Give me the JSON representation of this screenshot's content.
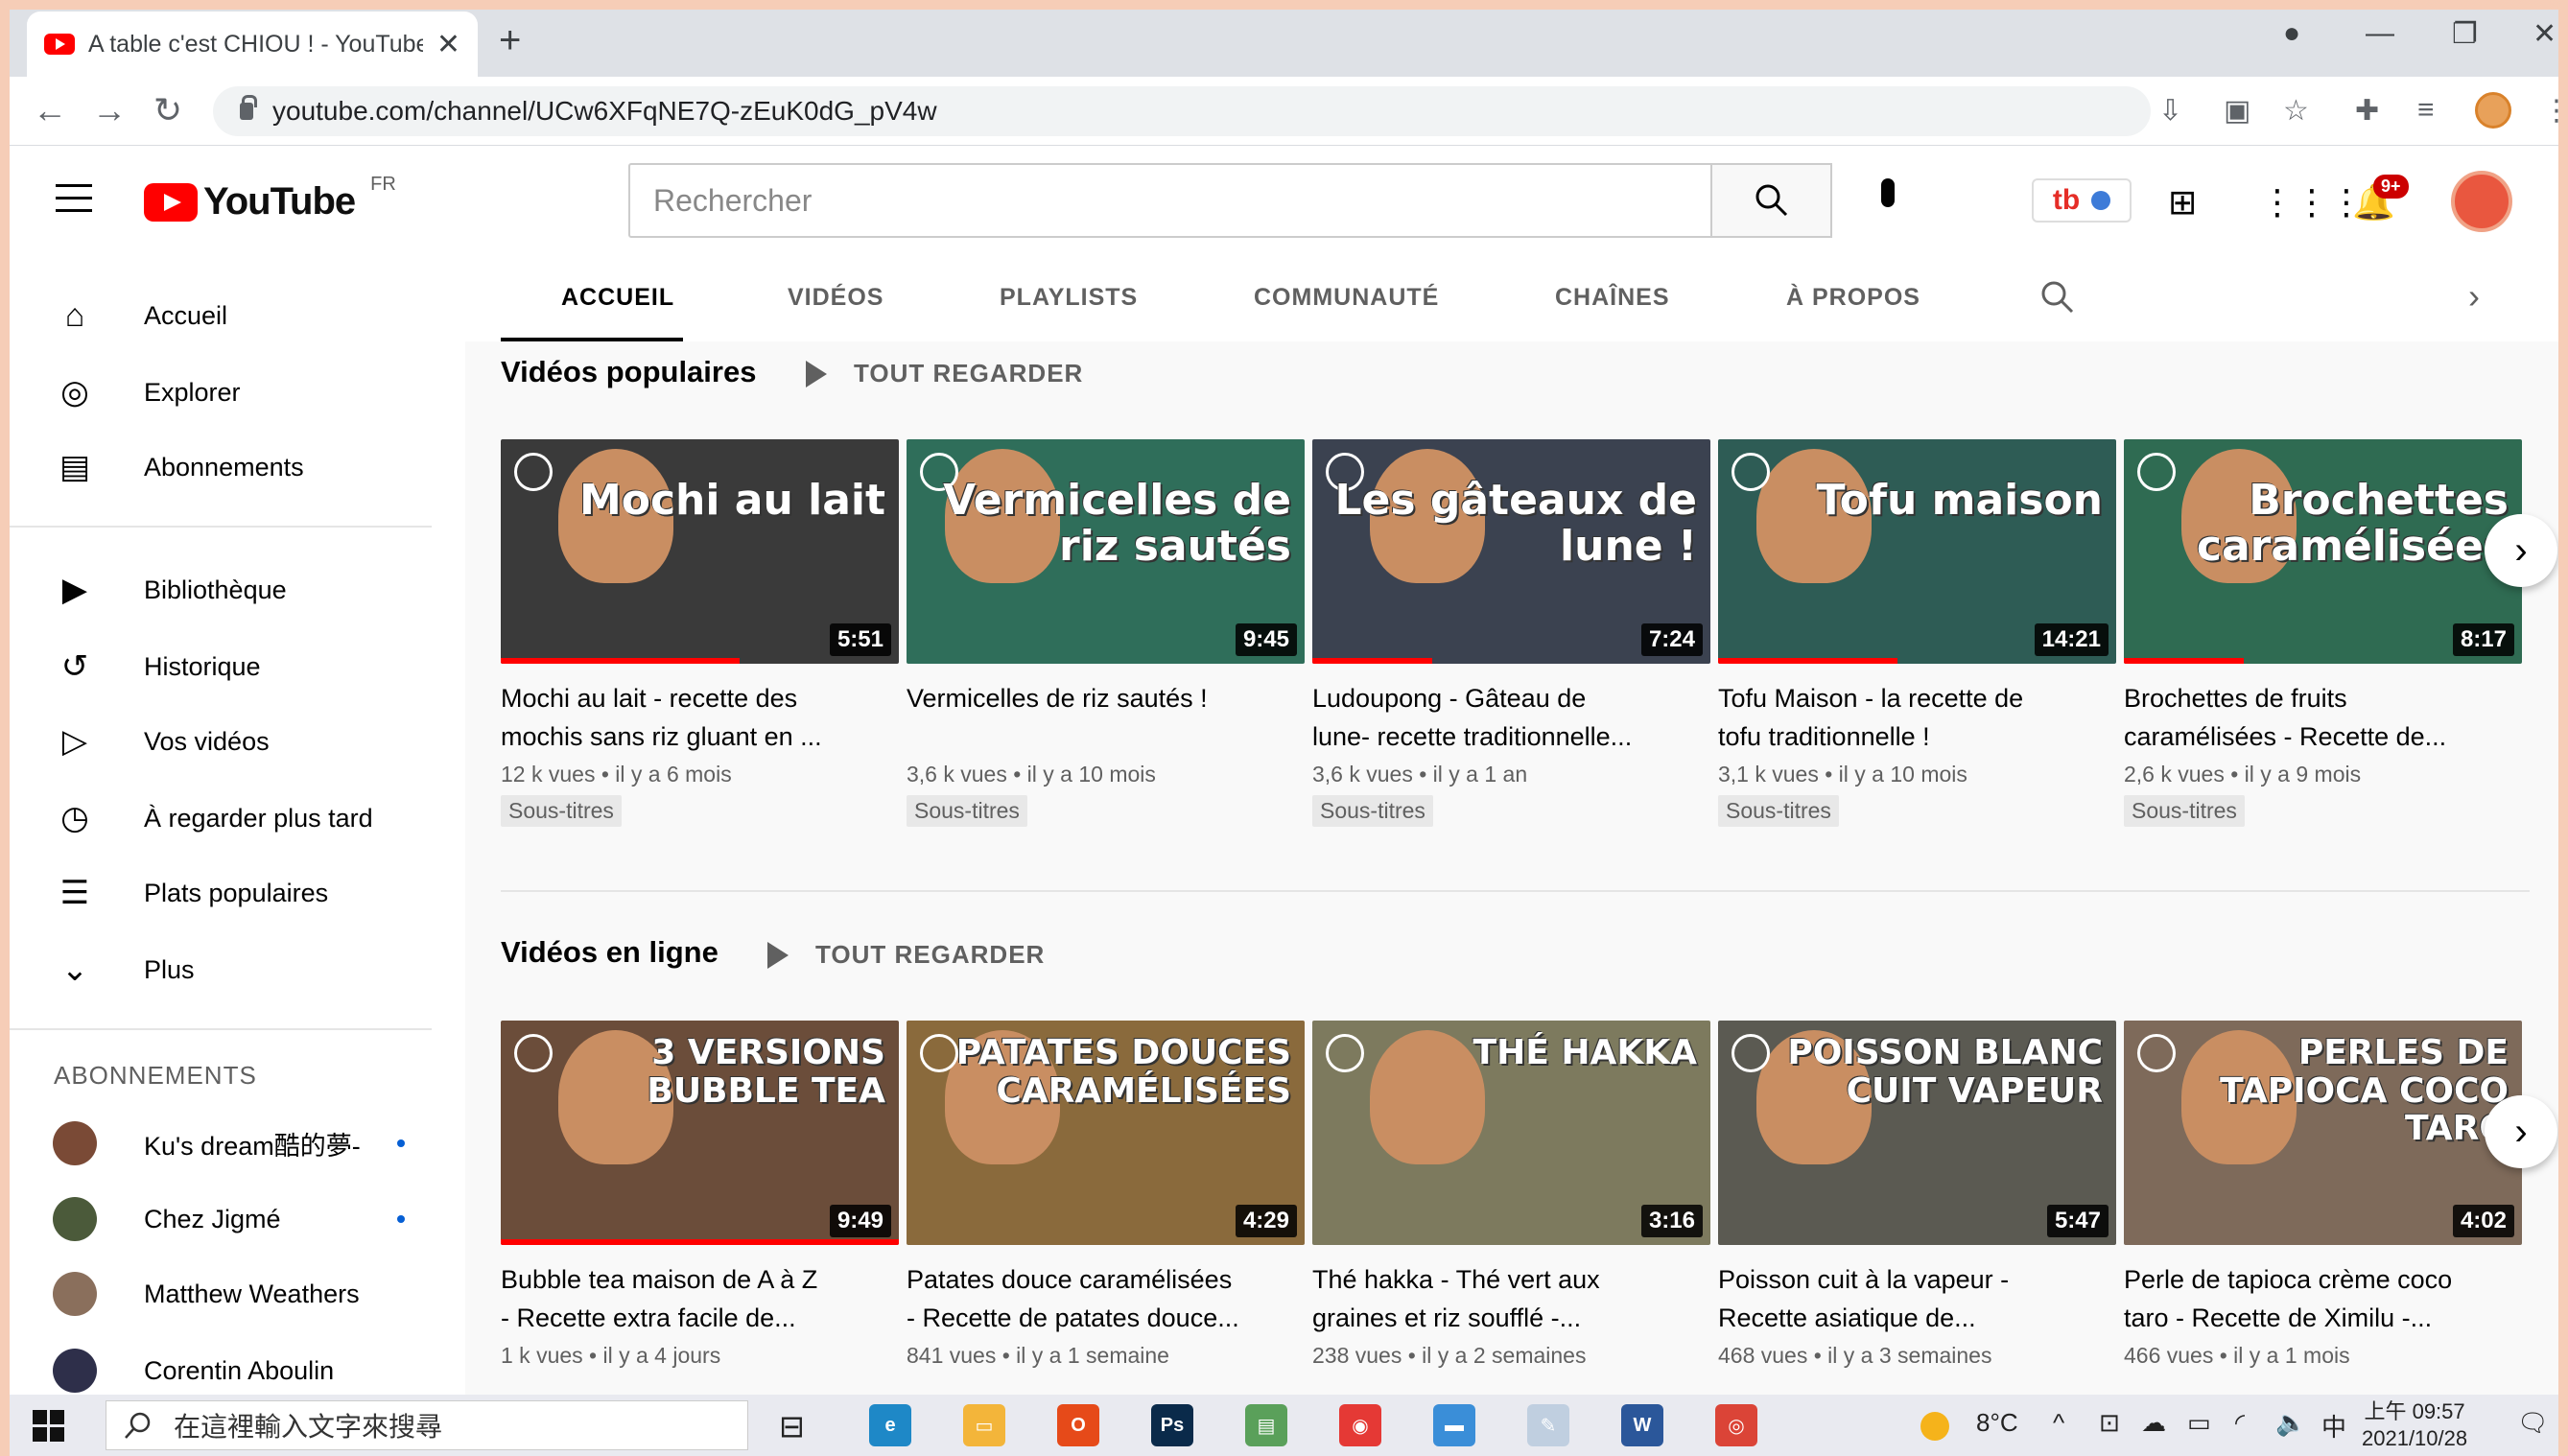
{
  "browser": {
    "tab_title": "A table c'est CHIOU ! - YouTube",
    "tab_close": "✕",
    "new_tab": "+",
    "url": "youtube.com/channel/UCw6XFqNE7Q-zEuK0dG_pV4w"
  },
  "masthead": {
    "logo_text": "YouTube",
    "region": "FR",
    "search_placeholder": "Rechercher",
    "notifications_badge": "9+"
  },
  "sidebar": {
    "main_items": [
      {
        "label": "Accueil",
        "icon": "home-icon"
      },
      {
        "label": "Explorer",
        "icon": "compass-icon"
      },
      {
        "label": "Abonnements",
        "icon": "subscriptions-icon"
      }
    ],
    "library_items": [
      {
        "label": "Bibliothèque",
        "icon": "library-icon"
      },
      {
        "label": "Historique",
        "icon": "history-icon"
      },
      {
        "label": "Vos vidéos",
        "icon": "your-videos-icon"
      },
      {
        "label": "À regarder plus tard",
        "icon": "watch-later-icon"
      },
      {
        "label": "Plats populaires",
        "icon": "playlist-icon"
      },
      {
        "label": "Plus",
        "icon": "chevron-down-icon"
      }
    ],
    "subscriptions_heading": "ABONNEMENTS",
    "subscriptions": [
      {
        "name": "Ku's dream酷的夢-",
        "new": true,
        "color": "#7a4a36"
      },
      {
        "name": "Chez Jigmé",
        "new": true,
        "color": "#4b5a3a"
      },
      {
        "name": "Matthew Weathers",
        "new": false,
        "color": "#8a6f5c"
      },
      {
        "name": "Corentin Aboulin",
        "new": false,
        "color": "#2e2f4a"
      }
    ]
  },
  "channel_tabs": [
    "ACCUEIL",
    "VIDÉOS",
    "PLAYLISTS",
    "COMMUNAUTÉ",
    "CHAÎNES",
    "À PROPOS"
  ],
  "shelves": [
    {
      "title": "Vidéos populaires",
      "play_all": "TOUT REGARDER",
      "videos": [
        {
          "overlay": "Mochi au lait",
          "duration": "5:51",
          "title_l1": "Mochi au lait - recette des",
          "title_l2": "mochis sans riz gluant en ...",
          "meta": "12 k vues • il y a 6 mois",
          "badge": "Sous-titres",
          "bg": "#3a3a3a",
          "progress": 0.6
        },
        {
          "overlay": "Vermicelles de riz sautés",
          "duration": "9:45",
          "title_l1": "Vermicelles de riz sautés !",
          "title_l2": "",
          "meta": "3,6 k vues • il y a 10 mois",
          "badge": "Sous-titres",
          "bg": "#2f6e5a",
          "progress": 0
        },
        {
          "overlay": "Les gâteaux de lune !",
          "duration": "7:24",
          "title_l1": "Ludoupong - Gâteau de",
          "title_l2": "lune- recette traditionnelle...",
          "meta": "3,6 k vues • il y a 1 an",
          "badge": "Sous-titres",
          "bg": "#3b4250",
          "progress": 0.3
        },
        {
          "overlay": "Tofu maison",
          "duration": "14:21",
          "title_l1": "Tofu Maison - la recette de",
          "title_l2": "tofu traditionnelle !",
          "meta": "3,1 k vues • il y a 10 mois",
          "badge": "Sous-titres",
          "bg": "#2e5c55",
          "progress": 0.45
        },
        {
          "overlay": "Brochettes caramélisées",
          "duration": "8:17",
          "title_l1": "Brochettes de fruits",
          "title_l2": "caramélisées - Recette de...",
          "meta": "2,6 k vues • il y a 9 mois",
          "badge": "Sous-titres",
          "bg": "#2f6b52",
          "progress": 0.3
        }
      ]
    },
    {
      "title": "Vidéos en ligne",
      "play_all": "TOUT REGARDER",
      "videos": [
        {
          "overlay": "3 VERSIONS BUBBLE TEA",
          "duration": "9:49",
          "title_l1": "Bubble tea maison de A à Z",
          "title_l2": "- Recette extra facile de...",
          "meta": "1 k vues • il y a 4 jours",
          "badge": "",
          "bg": "#6b4d3a",
          "progress": 1.0
        },
        {
          "overlay": "PATATES DOUCES CARAMÉLISÉES",
          "duration": "4:29",
          "title_l1": "Patates douce caramélisées",
          "title_l2": "- Recette de patates douce...",
          "meta": "841 vues • il y a 1 semaine",
          "badge": "",
          "bg": "#8a6a3c",
          "progress": 0
        },
        {
          "overlay": "THÉ HAKKA",
          "duration": "3:16",
          "title_l1": "Thé hakka - Thé vert aux",
          "title_l2": "graines et riz soufflé -...",
          "meta": "238 vues • il y a 2 semaines",
          "badge": "",
          "bg": "#7d7a5e",
          "progress": 0
        },
        {
          "overlay": "POISSON BLANC CUIT VAPEUR",
          "duration": "5:47",
          "title_l1": "Poisson cuit à la vapeur -",
          "title_l2": "Recette asiatique de...",
          "meta": "468 vues • il y a 3 semaines",
          "badge": "",
          "bg": "#5b5a52",
          "progress": 0
        },
        {
          "overlay": "PERLES DE TAPIOCA COCO TARO",
          "duration": "4:02",
          "title_l1": "Perle de tapioca crème coco",
          "title_l2": "taro - Recette de Ximilu -...",
          "meta": "466 vues • il y a 1 mois",
          "badge": "",
          "bg": "#7e6a5a",
          "progress": 0
        }
      ]
    }
  ],
  "taskbar": {
    "search_placeholder": "在這裡輸入文字來搜尋",
    "weather": "8°C",
    "ime": "中",
    "time": "上午 09:57",
    "date": "2021/10/28",
    "apps": [
      {
        "name": "Edge",
        "color": "#1e88c7",
        "label": "e"
      },
      {
        "name": "Files",
        "color": "#f3b53a",
        "label": "▭"
      },
      {
        "name": "Office",
        "color": "#e64a19",
        "label": "O"
      },
      {
        "name": "Photoshop",
        "color": "#0a2a4a",
        "label": "Ps"
      },
      {
        "name": "App",
        "color": "#5aa05a",
        "label": "▤"
      },
      {
        "name": "App2",
        "color": "#e53935",
        "label": "◉"
      },
      {
        "name": "Monitor",
        "color": "#3a8ed8",
        "label": "▬"
      },
      {
        "name": "Paint",
        "color": "#c0cfe0",
        "label": "✎"
      },
      {
        "name": "Word",
        "color": "#2b579a",
        "label": "W"
      },
      {
        "name": "Chrome",
        "color": "#db4437",
        "label": "◎"
      }
    ]
  },
  "colors": {
    "accent": "#ff0000",
    "link": "#065fd4"
  }
}
